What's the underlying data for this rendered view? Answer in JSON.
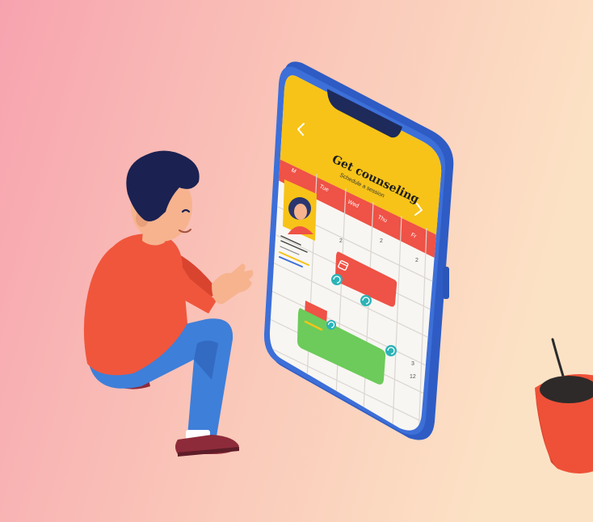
{
  "app": {
    "header_title": "Get counseling",
    "header_subtitle": "Schedule a session",
    "calendar": {
      "day_headers": [
        "M",
        "Tue",
        "Wed",
        "Thu",
        "Fr"
      ],
      "row_numbers": [
        "2",
        "2",
        "2",
        "3",
        "12"
      ]
    }
  },
  "colors": {
    "bg_left": "#F7A3AF",
    "bg_right": "#FCE2C5",
    "phone_frame": "#3D6FD8",
    "header_yellow": "#F7C318",
    "accent_red": "#EF5246",
    "accent_green": "#6CCB5A",
    "accent_teal": "#2BB3B7",
    "shirt": "#F0563C",
    "jeans": "#3E7FD9",
    "hair": "#1B2151",
    "pot": "#EE5138"
  },
  "icons": [
    "chevron-left-icon",
    "chevron-right-icon",
    "avatar",
    "calendar-icon",
    "refresh-icon"
  ]
}
